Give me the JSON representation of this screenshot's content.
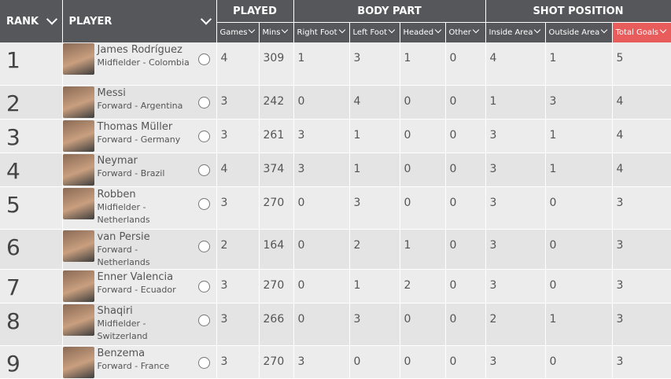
{
  "headers": {
    "rank": "RANK",
    "player": "PLAYER",
    "played": "PLAYED",
    "body_part": "BODY PART",
    "shot_position": "SHOT POSITION",
    "games": "Games",
    "mins": "Mins",
    "right_foot": "Right Foot",
    "left_foot": "Left Foot",
    "headed": "Headed",
    "other": "Other",
    "inside_area": "Inside Area",
    "outside_area": "Outside Area",
    "total_goals": "Total Goals"
  },
  "rows": [
    {
      "rank": "1",
      "name": "James Rodríguez",
      "info": "Midfielder - Colombia",
      "games": "4",
      "mins": "309",
      "right": "1",
      "left": "3",
      "headed": "1",
      "other": "0",
      "inside": "4",
      "outside": "1",
      "total": "5"
    },
    {
      "rank": "2",
      "name": "Messi",
      "info": "Forward - Argentina",
      "games": "3",
      "mins": "242",
      "right": "0",
      "left": "4",
      "headed": "0",
      "other": "0",
      "inside": "1",
      "outside": "3",
      "total": "4"
    },
    {
      "rank": "3",
      "name": "Thomas Müller",
      "info": "Forward - Germany",
      "games": "3",
      "mins": "261",
      "right": "3",
      "left": "1",
      "headed": "0",
      "other": "0",
      "inside": "3",
      "outside": "1",
      "total": "4"
    },
    {
      "rank": "4",
      "name": "Neymar",
      "info": "Forward - Brazil",
      "games": "4",
      "mins": "374",
      "right": "3",
      "left": "1",
      "headed": "0",
      "other": "0",
      "inside": "3",
      "outside": "1",
      "total": "4"
    },
    {
      "rank": "5",
      "name": "Robben",
      "info": "Midfielder - Netherlands",
      "games": "3",
      "mins": "270",
      "right": "0",
      "left": "3",
      "headed": "0",
      "other": "0",
      "inside": "3",
      "outside": "0",
      "total": "3"
    },
    {
      "rank": "6",
      "name": "van Persie",
      "info": "Forward - Netherlands",
      "games": "2",
      "mins": "164",
      "right": "0",
      "left": "2",
      "headed": "1",
      "other": "0",
      "inside": "3",
      "outside": "0",
      "total": "3"
    },
    {
      "rank": "7",
      "name": "Enner Valencia",
      "info": "Forward - Ecuador",
      "games": "3",
      "mins": "270",
      "right": "0",
      "left": "1",
      "headed": "2",
      "other": "0",
      "inside": "3",
      "outside": "0",
      "total": "3"
    },
    {
      "rank": "8",
      "name": "Shaqiri",
      "info": "Midfielder - Switzerland",
      "games": "3",
      "mins": "266",
      "right": "0",
      "left": "3",
      "headed": "0",
      "other": "0",
      "inside": "2",
      "outside": "1",
      "total": "3"
    },
    {
      "rank": "9",
      "name": "Benzema",
      "info": "Forward - France",
      "games": "3",
      "mins": "270",
      "right": "3",
      "left": "0",
      "headed": "0",
      "other": "0",
      "inside": "3",
      "outside": "0",
      "total": "3"
    }
  ],
  "colors": {
    "header_bg": "#55575a",
    "active_sort": "#e85c5c",
    "row_bg": "#ececec"
  },
  "icons": {
    "sort": "chevron-down-icon",
    "select": "radio-button"
  }
}
